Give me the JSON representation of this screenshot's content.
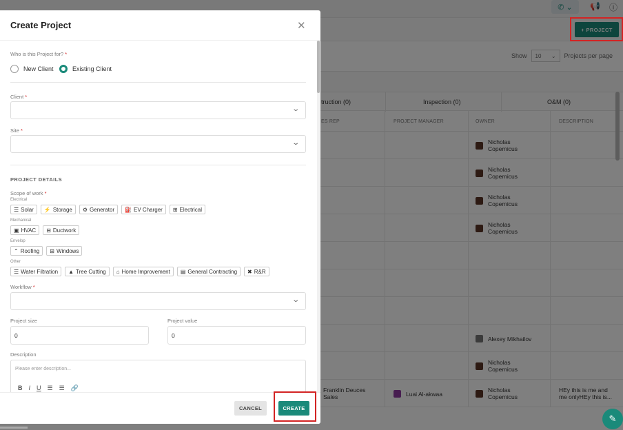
{
  "background": {
    "add_project_label": "+ PROJECT",
    "show_label": "Show",
    "per_page_value": "10",
    "per_page_suffix": "Projects per page",
    "tabs": [
      "truction (0)",
      "Inspection (0)",
      "O&M (0)"
    ],
    "columns": [
      "ES REP",
      "PROJECT MANAGER",
      "OWNER",
      "DESCRIPTION"
    ],
    "owners": [
      "Nicholas\nCopernicus",
      "Nicholas\nCopernicus",
      "Nicholas\nCopernicus",
      "Nicholas\nCopernicus",
      "Alexey Mikhailov",
      "Nicholas\nCopernicus",
      "Nicholas\nCopernicus"
    ],
    "last_row": {
      "sales_rep": "Franklin Deuces\nSales",
      "project_manager": "Luai Al-akwaa",
      "owner": "Nicholas\nCopernicus",
      "description": "HEy this is me and\nme onlyHEy this is..."
    }
  },
  "modal": {
    "title": "Create Project",
    "who_label": "Who is this Project for?",
    "radio_new": "New Client",
    "radio_existing": "Existing Client",
    "selected_radio": "Existing Client",
    "client_label": "Client",
    "site_label": "Site",
    "section_title": "PROJECT DETAILS",
    "scope_label": "Scope of work",
    "groups": [
      {
        "name": "Electrical",
        "chips": [
          {
            "icon": "solar-icon",
            "glyph": "☰",
            "label": "Solar"
          },
          {
            "icon": "storage-icon",
            "glyph": "⚡",
            "label": "Storage"
          },
          {
            "icon": "generator-icon",
            "glyph": "⚙",
            "label": "Generator"
          },
          {
            "icon": "ev-charger-icon",
            "glyph": "⛽",
            "label": "EV Charger"
          },
          {
            "icon": "electrical-icon",
            "glyph": "⊞",
            "label": "Electrical"
          }
        ]
      },
      {
        "name": "Mechanical",
        "chips": [
          {
            "icon": "hvac-icon",
            "glyph": "▣",
            "label": "HVAC"
          },
          {
            "icon": "ductwork-icon",
            "glyph": "⊟",
            "label": "Ductwork"
          }
        ]
      },
      {
        "name": "Envelop",
        "chips": [
          {
            "icon": "roofing-icon",
            "glyph": "⌃",
            "label": "Roofing"
          },
          {
            "icon": "windows-icon",
            "glyph": "⊞",
            "label": "Windows"
          }
        ]
      },
      {
        "name": "Other",
        "chips": [
          {
            "icon": "water-filtration-icon",
            "glyph": "☰",
            "label": "Water Filtration"
          },
          {
            "icon": "tree-cutting-icon",
            "glyph": "▲",
            "label": "Tree Cutting"
          },
          {
            "icon": "home-improvement-icon",
            "glyph": "⌂",
            "label": "Home Improvement"
          },
          {
            "icon": "general-contracting-icon",
            "glyph": "▤",
            "label": "General Contracting"
          },
          {
            "icon": "r-and-r-icon",
            "glyph": "✖",
            "label": "R&R"
          }
        ]
      }
    ],
    "workflow_label": "Workflow",
    "project_size_label": "Project size",
    "project_size_value": "0",
    "project_value_label": "Project value",
    "project_value_value": "0",
    "description_label": "Description",
    "description_placeholder": "Please enter description...",
    "cancel_label": "CANCEL",
    "create_label": "CREATE"
  },
  "colors": {
    "accent": "#1a8a7a",
    "highlight": "#d32323"
  }
}
